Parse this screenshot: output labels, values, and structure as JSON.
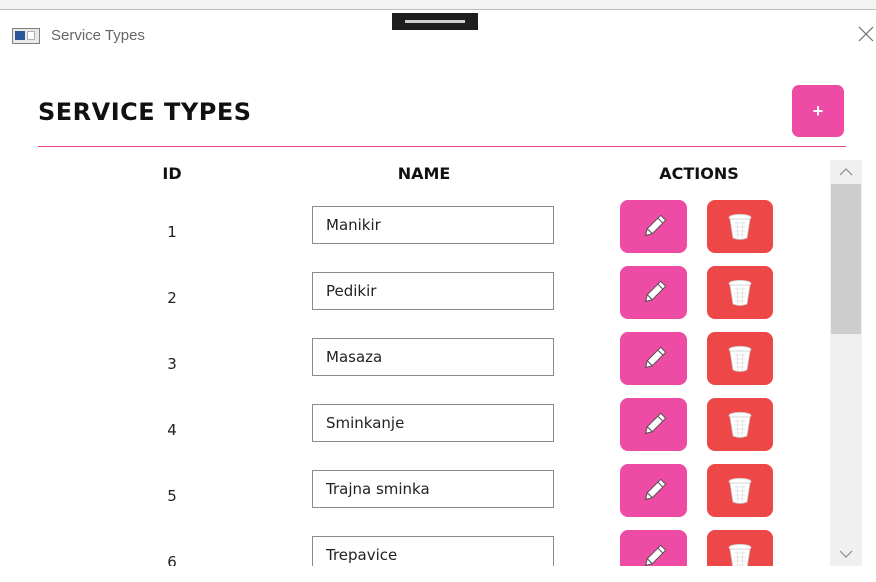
{
  "window": {
    "title": "Service Types"
  },
  "page": {
    "title": "SERVICE TYPES",
    "add_label": "+"
  },
  "table": {
    "columns": {
      "id": "ID",
      "name": "NAME",
      "actions": "ACTIONS"
    },
    "rows": [
      {
        "id": "1",
        "name": "Manikir"
      },
      {
        "id": "2",
        "name": "Pedikir"
      },
      {
        "id": "3",
        "name": "Masaza"
      },
      {
        "id": "4",
        "name": "Sminkanje"
      },
      {
        "id": "5",
        "name": "Trajna sminka"
      },
      {
        "id": "6",
        "name": "Trepavice"
      }
    ]
  },
  "icons": {
    "app": "app-window-icon",
    "close": "close-icon",
    "edit": "pencil-icon",
    "delete": "trash-icon",
    "scroll_up": "chevron-up-icon",
    "scroll_down": "chevron-down-icon"
  },
  "colors": {
    "accent_pink": "#ee4ba5",
    "delete_red": "#ee4747",
    "divider": "#e8458c"
  }
}
